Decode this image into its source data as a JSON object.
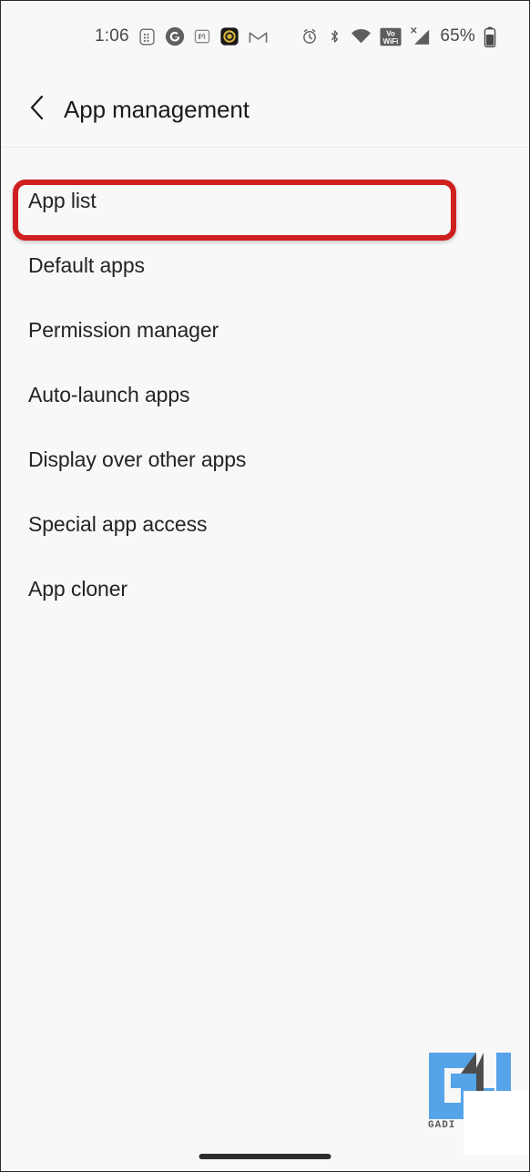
{
  "statusbar": {
    "time": "1:06",
    "battery_percent": "65%",
    "left_icons": [
      {
        "name": "keypad-icon",
        "label": "Dialer"
      },
      {
        "name": "google-icon",
        "label": "Google"
      },
      {
        "name": "mastodon-icon",
        "label": "Mastodon"
      },
      {
        "name": "app-notification-icon",
        "label": "App"
      },
      {
        "name": "gmail-icon",
        "label": "Gmail"
      }
    ],
    "right_icons": [
      {
        "name": "alarm-icon",
        "label": "Alarm"
      },
      {
        "name": "bluetooth-icon",
        "label": "Bluetooth"
      },
      {
        "name": "wifi-icon",
        "label": "Wi-Fi"
      },
      {
        "name": "vowifi-icon",
        "label": "VoWiFi"
      },
      {
        "name": "cellular-signal-icon",
        "label": "No SIM signal"
      },
      {
        "name": "battery-icon",
        "label": "Battery"
      }
    ]
  },
  "header": {
    "back_icon": "chevron-left-icon",
    "title": "App management"
  },
  "list": {
    "items": [
      {
        "label": "App list",
        "highlighted": true
      },
      {
        "label": "Default apps",
        "highlighted": false
      },
      {
        "label": "Permission manager",
        "highlighted": false
      },
      {
        "label": "Auto-launch apps",
        "highlighted": false
      },
      {
        "label": "Display over other apps",
        "highlighted": false
      },
      {
        "label": "Special app access",
        "highlighted": false
      },
      {
        "label": "App cloner",
        "highlighted": false
      }
    ]
  },
  "annotation": {
    "color": "#cf1f1f",
    "target": "App list"
  },
  "watermark": {
    "text": "GADI",
    "logo": "GU",
    "blue": "#55a3e8",
    "gray": "#4d4d4d"
  },
  "navigation": {
    "gesture_bar": "home-gesture-bar"
  },
  "theme": {
    "background": "#f8f8f8",
    "text_primary": "#242424",
    "text_secondary": "#4a4a4a",
    "divider": "#ececec"
  }
}
